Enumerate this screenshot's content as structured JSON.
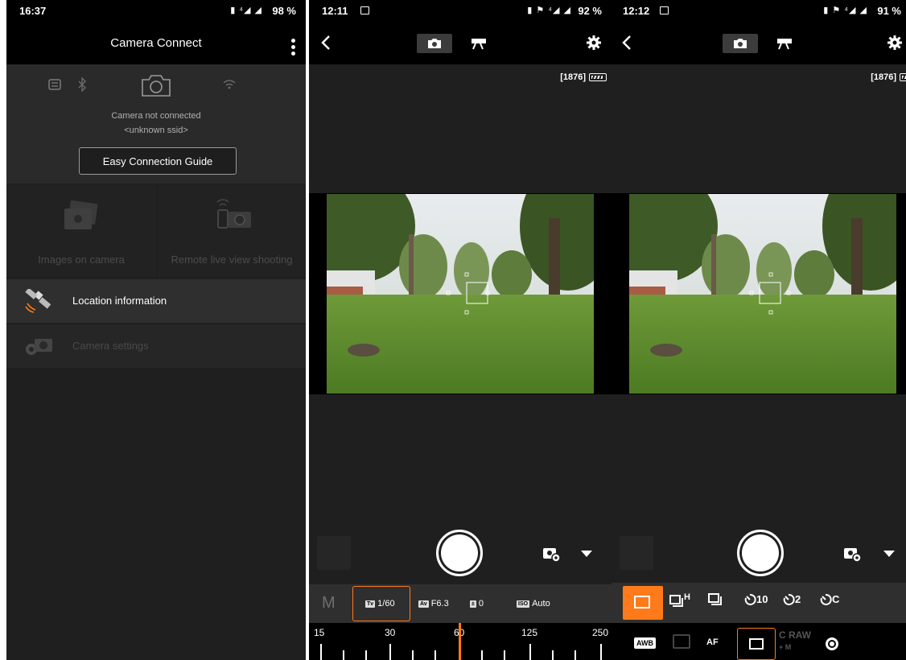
{
  "screen1": {
    "status": {
      "time": "16:37",
      "battery": "98 %"
    },
    "title": "Camera Connect",
    "connection": {
      "status": "Camera not connected",
      "ssid": "<unknown ssid>",
      "guide_button": "Easy Connection Guide"
    },
    "tiles": [
      {
        "label": "Images on camera",
        "icon": "images-on-camera-icon"
      },
      {
        "label": "Remote live view shooting",
        "icon": "remote-shooting-icon"
      }
    ],
    "menu": [
      {
        "label": "Location information",
        "icon": "satellite-icon",
        "enabled": true
      },
      {
        "label": "Camera settings",
        "icon": "camera-settings-icon",
        "enabled": false
      }
    ]
  },
  "screen2": {
    "status": {
      "time": "12:11",
      "battery": "92 %"
    },
    "shots_remaining": "[1876]",
    "params": {
      "mode": "M",
      "tv_badge": "Tv",
      "tv": "1/60",
      "av_badge": "Av",
      "av": "F6.3",
      "exposure_badge": "±",
      "exposure": "0",
      "iso_badge": "ISO",
      "iso": "Auto"
    },
    "dial": {
      "labels": [
        "15",
        "30",
        "60",
        "125",
        "250"
      ],
      "selected": "60"
    }
  },
  "screen3": {
    "status": {
      "time": "12:12",
      "battery": "91 %"
    },
    "shots_remaining": "[1876]",
    "drive_modes": [
      "single-shot",
      "high-speed-continuous",
      "continuous",
      "self-timer-10s",
      "self-timer-2s",
      "self-timer-continuous"
    ],
    "drive_labels": {
      "hi": "H",
      "t10": "10",
      "t2": "2",
      "tc": "C"
    },
    "bottom": {
      "awb": "AWB",
      "af": "AF",
      "craw": "C RAW",
      "craw_sub": "+ M"
    }
  },
  "colors": {
    "accent": "#ff7a1a",
    "background": "#1f1f1f",
    "bar": "#000000"
  }
}
